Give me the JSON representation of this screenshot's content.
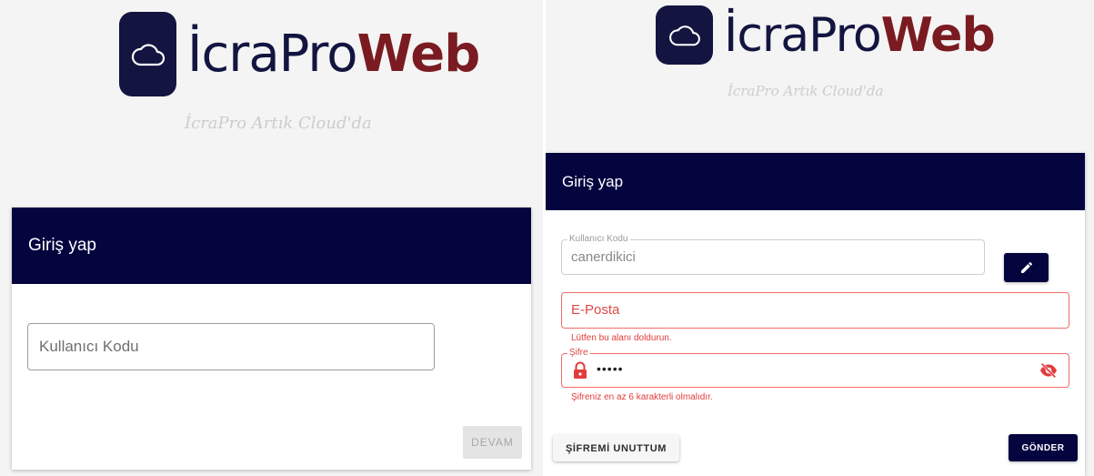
{
  "brand": {
    "word1": "İcraPro",
    "word2": "Web",
    "tagline": "İcraPro Artık Cloud'da",
    "colors": {
      "navy": "#131540",
      "maroon": "#7a1b22",
      "error": "#e04848"
    }
  },
  "left": {
    "title": "Giriş yap",
    "username_placeholder": "Kullanıcı Kodu",
    "continue_label": "DEVAM"
  },
  "right": {
    "title": "Giriş yap",
    "username_label": "Kullanıcı Kodu",
    "username_value": "canerdikici",
    "email_placeholder": "E-Posta",
    "email_error": "Lütfen bu alanı doldurun.",
    "password_label": "Şifre",
    "password_value": "•••••",
    "password_error": "Şifreniz en az 6 karakterli olmalıdır.",
    "forgot_label": "ŞİFREMİ UNUTTUM",
    "send_label": "GÖNDER"
  },
  "icons": [
    "cloud-icon",
    "edit-pencil-icon",
    "lock-icon",
    "eye-off-icon"
  ]
}
